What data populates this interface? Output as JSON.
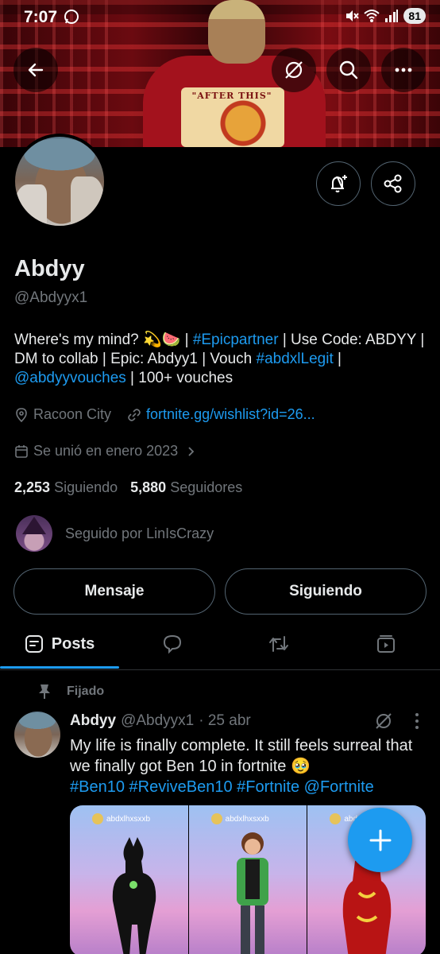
{
  "status_bar": {
    "time": "7:07",
    "battery": "81"
  },
  "profile": {
    "name": "Abdyy",
    "handle": "@Abdyyx1",
    "bio": {
      "t1": "Where's my mind? 💫🍉 | ",
      "link1": "#Epicpartner",
      "t2": " | Use Code: ABDYY | DM to collab | Epic: Abdyy1 | Vouch ",
      "link2": "#abdxlLegit",
      "t3": " | ",
      "link3": "@abdyyvouches",
      "t4": " | 100+ vouches"
    },
    "location": "Racoon City",
    "website": "fortnite.gg/wishlist?id=26...",
    "joined": "Se unió en enero 2023",
    "following_count": "2,253",
    "following_label": "Siguiendo",
    "followers_count": "5,880",
    "followers_label": "Seguidores",
    "followed_by": "Seguido por LinIsCrazy"
  },
  "actions": {
    "message": "Mensaje",
    "following": "Siguiendo"
  },
  "tabs": {
    "posts": "Posts"
  },
  "tweet": {
    "pinned_label": "Fijado",
    "name": "Abdyy",
    "handle": "@Abdyyx1",
    "date": "· 25 abr",
    "text": "My life is finally complete. It still feels surreal that we finally got Ben 10 in fortnite 🥹",
    "hashtags": "#Ben10 #ReviveBen10 #Fortnite @Fortnite",
    "media_user": "abdxlhxsxxb"
  },
  "banner": {
    "shirt_text": "\"AFTER THIS\""
  },
  "colors": {
    "accent": "#1d9bf0",
    "background": "#000000",
    "muted": "#71767b",
    "border": "#536471"
  },
  "icons": {
    "back": "back-arrow-icon",
    "grok": "grok-icon",
    "search": "search-icon",
    "more": "more-icon",
    "notify": "bell-plus-icon",
    "share": "share-icon",
    "location": "location-pin-icon",
    "link": "link-icon",
    "calendar": "calendar-icon",
    "chevron": "chevron-right-icon",
    "posts": "posts-icon",
    "replies": "reply-icon",
    "reposts": "repost-icon",
    "videos": "video-icon",
    "pin": "pin-icon",
    "compose": "plus-icon"
  }
}
